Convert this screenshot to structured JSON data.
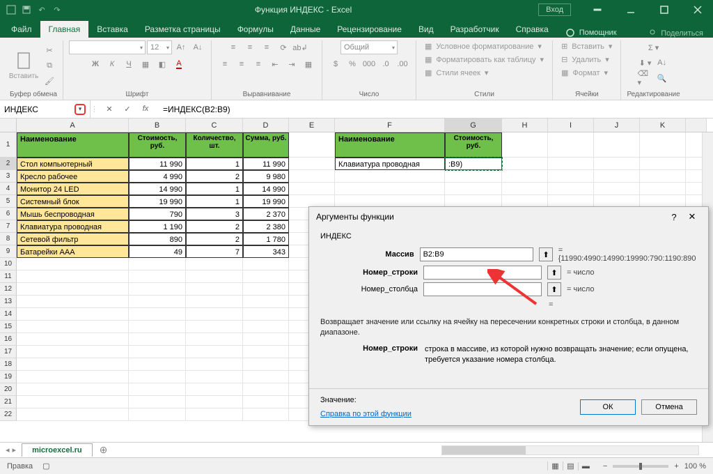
{
  "titlebar": {
    "title": "Функция ИНДЕКС  -  Excel",
    "login": "Вход"
  },
  "tabs": {
    "file": "Файл",
    "home": "Главная",
    "insert": "Вставка",
    "layout": "Разметка страницы",
    "formulas": "Формулы",
    "data": "Данные",
    "review": "Рецензирование",
    "view": "Вид",
    "dev": "Разработчик",
    "help": "Справка",
    "assistant": "Помощник",
    "share": "Поделиться"
  },
  "ribbon": {
    "clipboard": {
      "paste": "Вставить",
      "label": "Буфер обмена"
    },
    "font": {
      "name": "",
      "size": "12",
      "bold": "Ж",
      "italic": "К",
      "underline": "Ч",
      "label": "Шрифт"
    },
    "align": {
      "label": "Выравнивание"
    },
    "number": {
      "format": "Общий",
      "label": "Число"
    },
    "styles": {
      "cond": "Условное форматирование",
      "table": "Форматировать как таблицу",
      "cells": "Стили ячеек",
      "label": "Стили"
    },
    "cells": {
      "insert": "Вставить",
      "delete": "Удалить",
      "format": "Формат",
      "label": "Ячейки"
    },
    "editing": {
      "label": "Редактирование"
    }
  },
  "fbar": {
    "name": "ИНДЕКС",
    "formula": "=ИНДЕКС(B2:B9)"
  },
  "cols": [
    "A",
    "B",
    "C",
    "D",
    "E",
    "F",
    "G",
    "H",
    "I",
    "J",
    "K"
  ],
  "headers": {
    "a": "Наименование",
    "b": "Стоимость, руб.",
    "c": "Количество, шт.",
    "d": "Сумма, руб.",
    "f": "Наименование",
    "g": "Стоимость, руб."
  },
  "table": [
    {
      "n": "Стол компьютерный",
      "p": "11 990",
      "q": "1",
      "s": "11 990"
    },
    {
      "n": "Кресло рабочее",
      "p": "4 990",
      "q": "2",
      "s": "9 980"
    },
    {
      "n": "Монитор 24 LED",
      "p": "14 990",
      "q": "1",
      "s": "14 990"
    },
    {
      "n": "Системный блок",
      "p": "19 990",
      "q": "1",
      "s": "19 990"
    },
    {
      "n": "Мышь беспроводная",
      "p": "790",
      "q": "3",
      "s": "2 370"
    },
    {
      "n": "Клавиатура проводная",
      "p": "1 190",
      "q": "2",
      "s": "2 380"
    },
    {
      "n": "Сетевой фильтр",
      "p": "890",
      "q": "2",
      "s": "1 780"
    },
    {
      "n": "Батарейки AAA",
      "p": "49",
      "q": "7",
      "s": "343"
    }
  ],
  "f2": "Клавиатура проводная",
  "g2": ":B9)",
  "dialog": {
    "title": "Аргументы функции",
    "func": "ИНДЕКС",
    "arg1": {
      "label": "Массив",
      "value": "B2:B9",
      "result": "=  {11990:4990:14990:19990:790:1190:890"
    },
    "arg2": {
      "label": "Номер_строки",
      "value": "",
      "result": "=  число"
    },
    "arg3": {
      "label": "Номер_столбца",
      "value": "",
      "result": "=  число"
    },
    "eq": "=",
    "desc": "Возвращает значение или ссылку на ячейку на пересечении конкретных строки и столбца, в данном диапазоне.",
    "argdesc_label": "Номер_строки",
    "argdesc_text": "строка в массиве, из которой нужно возвращать значение; если опущена, требуется указание номера столбца.",
    "result_label": "Значение:",
    "help": "Справка по этой функции",
    "ok": "ОК",
    "cancel": "Отмена",
    "help_q": "?"
  },
  "sheet": "microexcel.ru",
  "status": {
    "mode": "Правка",
    "zoom": "100 %"
  }
}
